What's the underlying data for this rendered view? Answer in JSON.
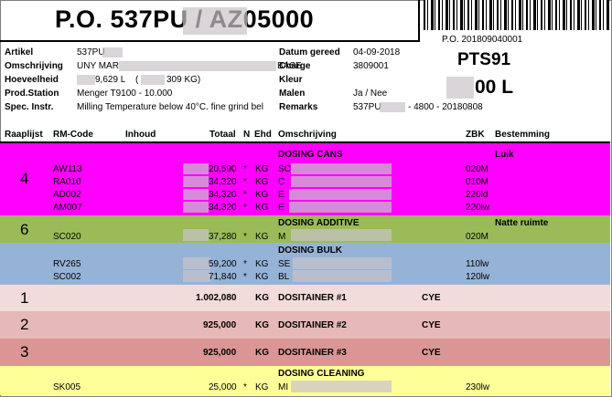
{
  "header": {
    "po_title": "P.O. 537PU / AZ05000",
    "po_number": "P.O. 201809040001",
    "pts": "PTS91",
    "volume": "00 L",
    "info": {
      "artikel_label": "Artikel",
      "artikel_value": "537PU",
      "omschrijving_label": "Omschrijving",
      "omschrijving_value": "UNY MAR",
      "omschrijving_tail": "BASE",
      "hoeveelheid_label": "Hoeveelheid",
      "hoeveelheid_value": "9,629 L",
      "hoeveelheid_kg": "309 KG)",
      "prod_label": "Prod.Station",
      "prod_value": "Menger T9100 - 10.000",
      "spec_label": "Spec. Instr.",
      "spec_value": "Milling Temperature below 40°C. fine grind bel",
      "datum_label": "Datum gereed",
      "datum_value": "04-09-2018",
      "charge_label": "Charge",
      "charge_value": "3809001",
      "kleur_label": "Kleur",
      "kleur_value": "",
      "malen_label": "Malen",
      "malen_value": "Ja / Nee",
      "remarks_label": "Remarks",
      "remarks_value": "537PU",
      "remarks_tail": "- 4800 - 20180808"
    }
  },
  "columns": {
    "raaplijst": "Raaplijst",
    "rmcode": "RM-Code",
    "inhoud": "Inhoud",
    "totaal": "Totaal",
    "n": "N",
    "ehd": "Ehd",
    "omschrijving": "Omschrijving",
    "zbk": "ZBK",
    "bestemming": "Bestemming"
  },
  "sections": [
    {
      "number": "4",
      "title": "DOSING CANS",
      "bestemming": "Luik",
      "color": "#ff00ff",
      "rows": [
        {
          "code": "AW113",
          "totaal": "20,590",
          "n": "*",
          "ehd": "KG",
          "omschr": "SC",
          "zbk": "020M"
        },
        {
          "code": "RA010",
          "totaal": "34,320",
          "n": "*",
          "ehd": "KG",
          "omschr": "C",
          "zbk": "010M"
        },
        {
          "code": "AD002",
          "totaal": "34,320",
          "n": "*",
          "ehd": "KG",
          "omschr": "E",
          "zbk": "220ld"
        },
        {
          "code": "AM007",
          "totaal": "34,320",
          "n": "*",
          "ehd": "KG",
          "omschr": "E",
          "zbk": "220lw"
        }
      ]
    },
    {
      "number": "6",
      "title": "DOSING ADDITIVE",
      "bestemming": "Natte ruimte",
      "color": "#9bbb59",
      "rows": [
        {
          "code": "SC020",
          "totaal": "37,280",
          "n": "*",
          "ehd": "KG",
          "omschr": "M",
          "zbk": "020M"
        }
      ]
    },
    {
      "number": "",
      "title": "DOSING BULK",
      "bestemming": "",
      "color": "#95b3d7",
      "rows": [
        {
          "code": "RV265",
          "totaal": "59,200",
          "n": "*",
          "ehd": "KG",
          "omschr": "SE",
          "zbk": "110lw"
        },
        {
          "code": "SC002",
          "totaal": "71,840",
          "n": "*",
          "ehd": "KG",
          "omschr": "BL",
          "zbk": "120lw"
        }
      ]
    }
  ],
  "dositainers": [
    {
      "number": "1",
      "totaal": "1.002,080",
      "ehd": "KG",
      "omschr": "DOSITAINER #1",
      "zbk": "CYE",
      "color": "#f2dcdb"
    },
    {
      "number": "2",
      "totaal": "925,000",
      "ehd": "KG",
      "omschr": "DOSITAINER #2",
      "zbk": "CYE",
      "color": "#e6b9b8"
    },
    {
      "number": "3",
      "totaal": "925,000",
      "ehd": "KG",
      "omschr": "DOSITAINER #3",
      "zbk": "CYE",
      "color": "#da9694"
    }
  ],
  "cleaning": {
    "title": "DOSING CLEANING",
    "color": "#ffff99",
    "rows": [
      {
        "code": "SK005",
        "totaal": "25,000",
        "n": "*",
        "ehd": "KG",
        "omschr": "MI",
        "zbk": "230lw"
      }
    ]
  }
}
